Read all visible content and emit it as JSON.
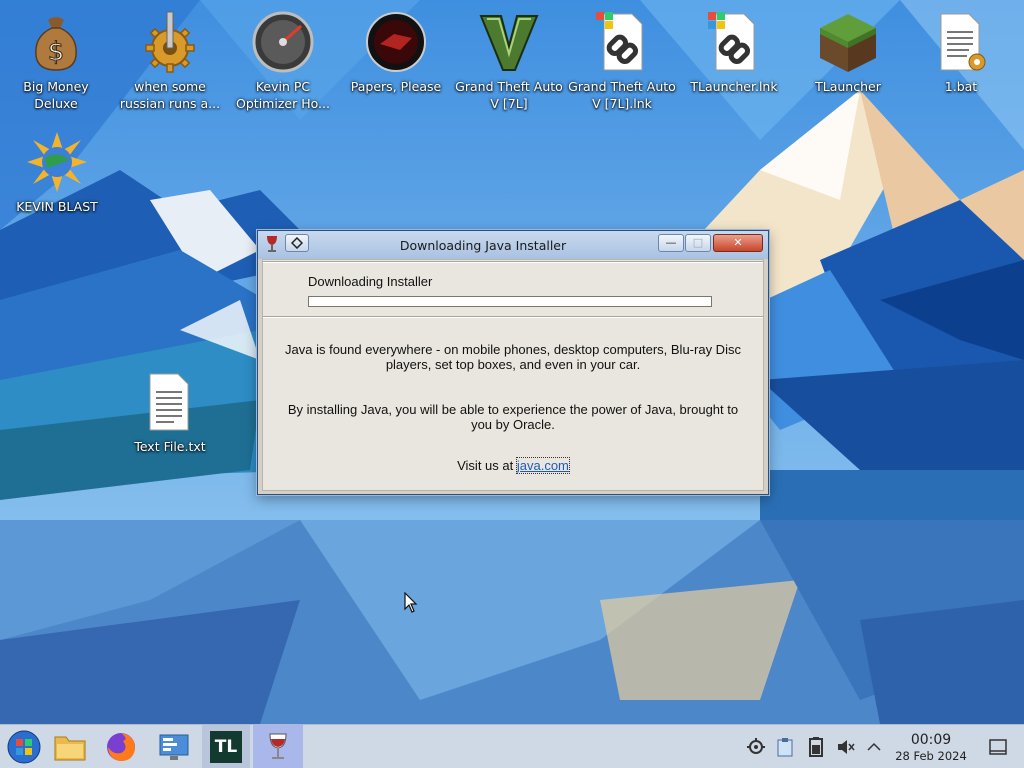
{
  "desktop": {
    "icons": [
      {
        "label": "Big Money Deluxe",
        "icon": "money-bag-icon"
      },
      {
        "label": "when some russian runs a...",
        "icon": "gear-icon"
      },
      {
        "label": "Kevin PC Optimizer Ho...",
        "icon": "gauge-icon"
      },
      {
        "label": "Papers, Please",
        "icon": "papers-please-icon"
      },
      {
        "label": "Grand Theft Auto V [7L]",
        "icon": "gta-v-icon"
      },
      {
        "label": "Grand Theft Auto V [7L].lnk",
        "icon": "shortcut-file-icon"
      },
      {
        "label": "TLauncher.lnk",
        "icon": "shortcut-file-icon"
      },
      {
        "label": "TLauncher",
        "icon": "grass-block-icon"
      },
      {
        "label": "1.bat",
        "icon": "batch-file-icon"
      },
      {
        "label": "KEVIN BLAST",
        "icon": "globe-burst-icon"
      },
      {
        "label": "Text File.txt",
        "icon": "text-file-icon"
      }
    ]
  },
  "window": {
    "title": "Downloading Java Installer",
    "minimize_label": "—",
    "maximize_label": "□",
    "close_label": "✕",
    "download_label": "Downloading Installer",
    "progress": 1.0,
    "para1": "Java is found everywhere - on mobile phones, desktop computers, Blu-ray Disc players, set top boxes, and even in your car.",
    "para2": "By installing Java, you will be able to experience the power of Java, brought to you by Oracle.",
    "visit_prefix": "Visit us at",
    "visit_link": "java.com",
    "link_color": "#1f5bbf"
  },
  "taskbar": {
    "apps": [
      "start-orb-icon",
      "file-manager-icon",
      "firefox-icon",
      "control-panel-icon",
      "tlauncher-icon",
      "wine-glass-icon"
    ],
    "tlauncher_label": "TL",
    "tray": [
      "network-icon",
      "clipboard-icon",
      "battery-icon",
      "speaker-muted-icon",
      "chevron-up-icon"
    ],
    "time": "00:09",
    "date": "28 Feb 2024",
    "accent": "#cdd6e4"
  }
}
